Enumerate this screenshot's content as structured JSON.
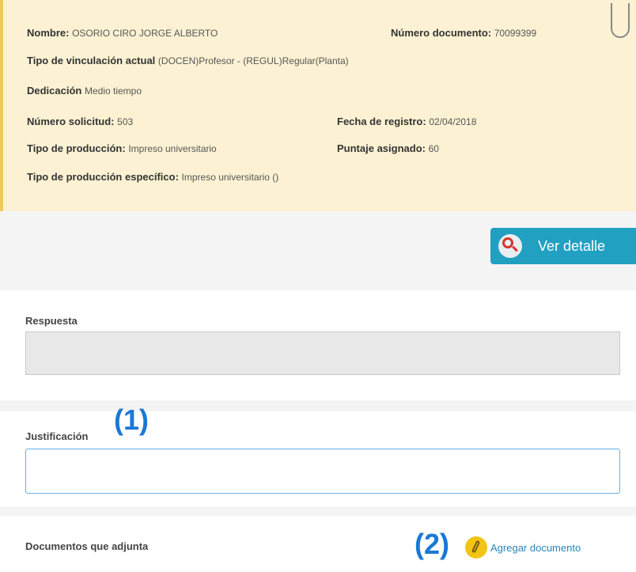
{
  "info": {
    "nombre_label": "Nombre:",
    "nombre_value": "OSORIO CIRO JORGE ALBERTO",
    "num_doc_label": "Número documento:",
    "num_doc_value": "70099399",
    "tipo_vinc_label": "Tipo de vinculación actual",
    "tipo_vinc_value": "(DOCEN)Profesor - (REGUL)Regular(Planta)",
    "dedicacion_label": "Dedicación",
    "dedicacion_value": "Medio tiempo",
    "num_sol_label": "Número solicitud:",
    "num_sol_value": "503",
    "fecha_label": "Fecha de registro:",
    "fecha_value": "02/04/2018",
    "tipo_prod_label": "Tipo de producción:",
    "tipo_prod_value": "Impreso universitario",
    "puntaje_label": "Puntaje asignado:",
    "puntaje_value": "60",
    "tipo_prod_esp_label": "Tipo de producción específico:",
    "tipo_prod_esp_value": "Impreso universitario ()"
  },
  "actions": {
    "ver_detalle": "Ver detalle",
    "agregar_documento": "Agregar documento"
  },
  "form": {
    "respuesta_label": "Respuesta",
    "respuesta_value": "",
    "justificacion_label": "Justificación",
    "justificacion_value": "",
    "documentos_label": "Documentos que adjunta"
  },
  "annotations": {
    "one": "(1)",
    "two": "(2)"
  },
  "colors": {
    "info_bg": "#fcf2d3",
    "info_border": "#f0c860",
    "button_bg": "#21a0c2",
    "annotation": "#1a78d6",
    "link": "#2a86b8"
  },
  "icons": {
    "ver_detalle": "magnifier-icon",
    "agregar_documento": "paperclip-icon"
  }
}
